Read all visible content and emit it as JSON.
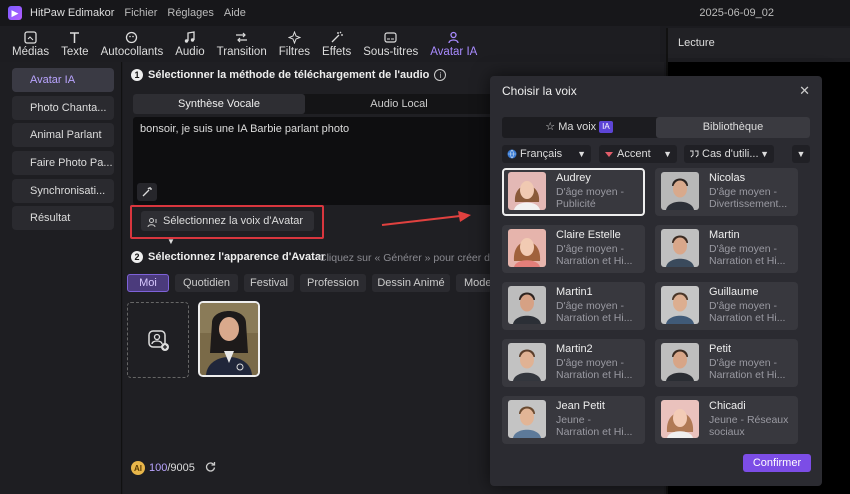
{
  "app": {
    "name": "HitPaw Edimakor",
    "menus": [
      "Fichier",
      "Réglages",
      "Aide"
    ],
    "date": "2025-06-09_02"
  },
  "toolbar": {
    "items": [
      {
        "label": "Médias",
        "icon": "media-icon"
      },
      {
        "label": "Texte",
        "icon": "text-icon"
      },
      {
        "label": "Autocollants",
        "icon": "sticker-icon"
      },
      {
        "label": "Audio",
        "icon": "audio-icon"
      },
      {
        "label": "Transition",
        "icon": "transition-icon"
      },
      {
        "label": "Filtres",
        "icon": "filter-icon"
      },
      {
        "label": "Effets",
        "icon": "effects-icon"
      },
      {
        "label": "Sous-titres",
        "icon": "subtitles-icon"
      },
      {
        "label": "Avatar IA",
        "icon": "avatar-icon"
      }
    ],
    "active": "Avatar IA"
  },
  "preview": {
    "title": "Lecture"
  },
  "sidebar": {
    "items": [
      "Avatar IA",
      "Photo Chanta...",
      "Animal Parlant",
      "Faire Photo Pa...",
      "Synchronisati...",
      "Résultat"
    ],
    "active": "Avatar IA"
  },
  "step1": {
    "num": "1",
    "title": "Sélectionner la méthode de téléchargement de l'audio",
    "info": "i",
    "tabs": [
      "Synthèse Vocale",
      "Audio Local"
    ],
    "text": "bonsoir, je suis une IA Barbie parlant photo",
    "voice_button": "Sélectionnez la voix d'Avatar"
  },
  "step2": {
    "num": "2",
    "title": "Sélectionnez l'apparence d'Avatar",
    "hint": "Cliquez sur « Générer » pour créer des",
    "categories": [
      "Moi",
      "Quotidien",
      "Festival",
      "Profession",
      "Dessin Animé",
      "Mode"
    ]
  },
  "credits": {
    "used": "100",
    "total": "/9005",
    "coin": "AI"
  },
  "modal": {
    "title": "Choisir la voix",
    "close": "✕",
    "tabs": {
      "my_voice": "Ma voix",
      "badge": "IA",
      "library": "Bibliothèque"
    },
    "filters": [
      "Français",
      "Accent",
      "Cas d'utili..."
    ],
    "voices": [
      {
        "name": "Audrey",
        "desc1": "D'âge moyen -",
        "desc2": "Publicité"
      },
      {
        "name": "Nicolas",
        "desc1": "D'âge moyen -",
        "desc2": "Divertissement..."
      },
      {
        "name": "Claire Estelle",
        "desc1": "D'âge moyen -",
        "desc2": "Narration et Hi..."
      },
      {
        "name": "Martin",
        "desc1": "D'âge moyen -",
        "desc2": "Narration et Hi..."
      },
      {
        "name": "Martin1",
        "desc1": "D'âge moyen -",
        "desc2": "Narration et Hi..."
      },
      {
        "name": "Guillaume",
        "desc1": "D'âge moyen -",
        "desc2": "Narration et Hi..."
      },
      {
        "name": "Martin2",
        "desc1": "D'âge moyen -",
        "desc2": "Narration et Hi..."
      },
      {
        "name": "Petit",
        "desc1": "D'âge moyen -",
        "desc2": "Narration et Hi..."
      },
      {
        "name": "Jean Petit",
        "desc1": "Jeune -",
        "desc2": "Narration et Hi..."
      },
      {
        "name": "Chicadi",
        "desc1": "Jeune - Réseaux",
        "desc2": "sociaux"
      }
    ],
    "confirm": "Confirmer"
  }
}
